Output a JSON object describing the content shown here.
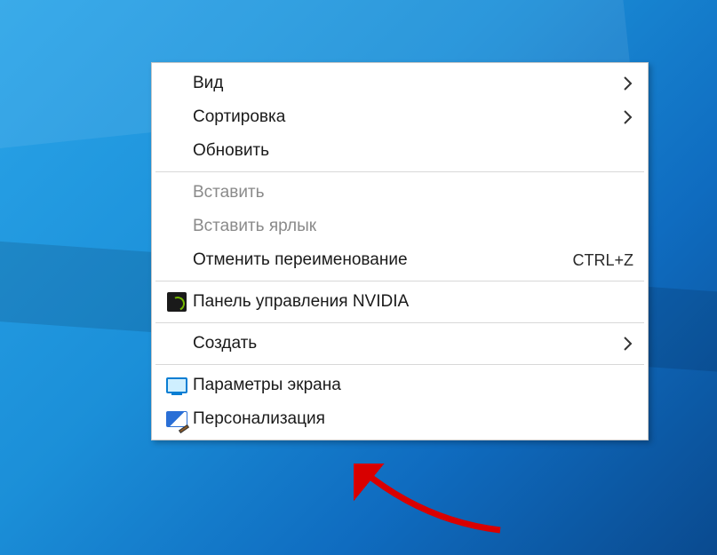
{
  "menu": {
    "items": [
      {
        "id": "view",
        "label": "Вид",
        "submenu": true,
        "enabled": true,
        "icon": null
      },
      {
        "id": "sort",
        "label": "Сортировка",
        "submenu": true,
        "enabled": true,
        "icon": null
      },
      {
        "id": "refresh",
        "label": "Обновить",
        "submenu": false,
        "enabled": true,
        "icon": null
      },
      {
        "sep": true
      },
      {
        "id": "paste",
        "label": "Вставить",
        "submenu": false,
        "enabled": false,
        "icon": null
      },
      {
        "id": "paste-shortcut",
        "label": "Вставить ярлык",
        "submenu": false,
        "enabled": false,
        "icon": null
      },
      {
        "id": "undo-rename",
        "label": "Отменить переименование",
        "submenu": false,
        "enabled": true,
        "icon": null,
        "accel": "CTRL+Z"
      },
      {
        "sep": true
      },
      {
        "id": "nvidia",
        "label": "Панель управления NVIDIA",
        "submenu": false,
        "enabled": true,
        "icon": "nvidia"
      },
      {
        "sep": true
      },
      {
        "id": "new",
        "label": "Создать",
        "submenu": true,
        "enabled": true,
        "icon": null
      },
      {
        "sep": true
      },
      {
        "id": "display",
        "label": "Параметры экрана",
        "submenu": false,
        "enabled": true,
        "icon": "display"
      },
      {
        "id": "personalize",
        "label": "Персонализация",
        "submenu": false,
        "enabled": true,
        "icon": "personalize"
      }
    ]
  },
  "pointer": {
    "target": "personalize",
    "color": "#d80000"
  }
}
